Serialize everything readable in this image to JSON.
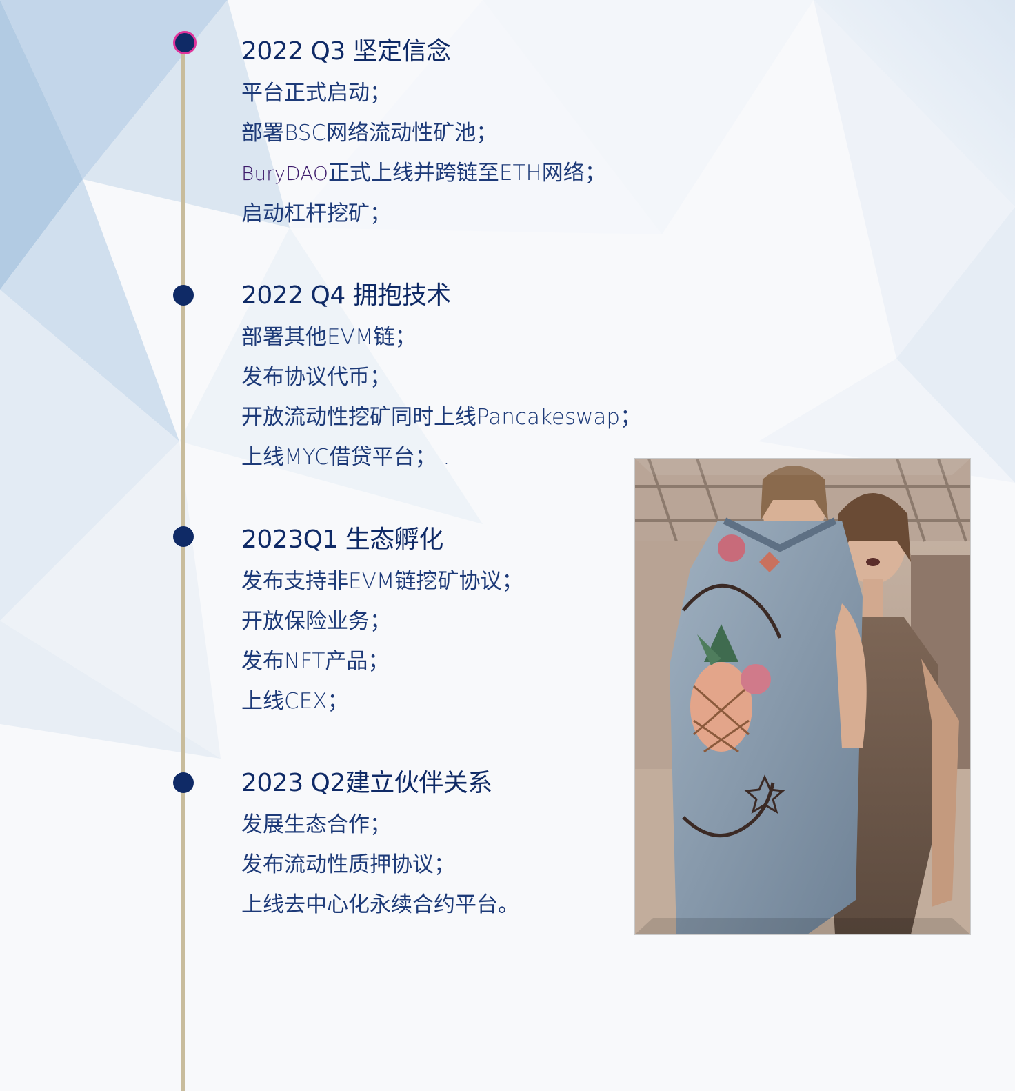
{
  "timeline": [
    {
      "title": "2022 Q3 坚定信念",
      "items": [
        {
          "text": "平台正式启动；"
        },
        {
          "text": "部署BSC网络流动性矿池；"
        },
        {
          "brand": "BuryDAO",
          "text": "正式上线并跨链至ETH网络；"
        },
        {
          "text": "启动杠杆挖矿；"
        }
      ]
    },
    {
      "title": "2022 Q4 拥抱技术",
      "items": [
        {
          "text": "部署其他EVM链；"
        },
        {
          "text": "发布协议代币；"
        },
        {
          "text": "开放流动性挖矿同时上线Pancakeswap；"
        },
        {
          "text": "上线MYC借贷平台；  ."
        }
      ]
    },
    {
      "title": "2023Q1 生态孵化",
      "items": [
        {
          "text": "发布支持非EVM链挖矿协议；"
        },
        {
          "text": "开放保险业务；"
        },
        {
          "text": "发布NFT产品；"
        },
        {
          "text": "上线CEX；"
        }
      ]
    },
    {
      "title": "2023 Q2建立伙伴关系",
      "items": [
        {
          "text": "发展生态合作；"
        },
        {
          "text": "发布流动性质押协议；"
        },
        {
          "text": "上线去中心化永续合约平台。"
        }
      ]
    }
  ],
  "colors": {
    "heading": "#0f2a66",
    "body": "#1d3a78",
    "brand": "#3d1b6b",
    "line": "#c8bc9c",
    "dot": "#0f2a66",
    "active_ring": "#e0339b"
  }
}
